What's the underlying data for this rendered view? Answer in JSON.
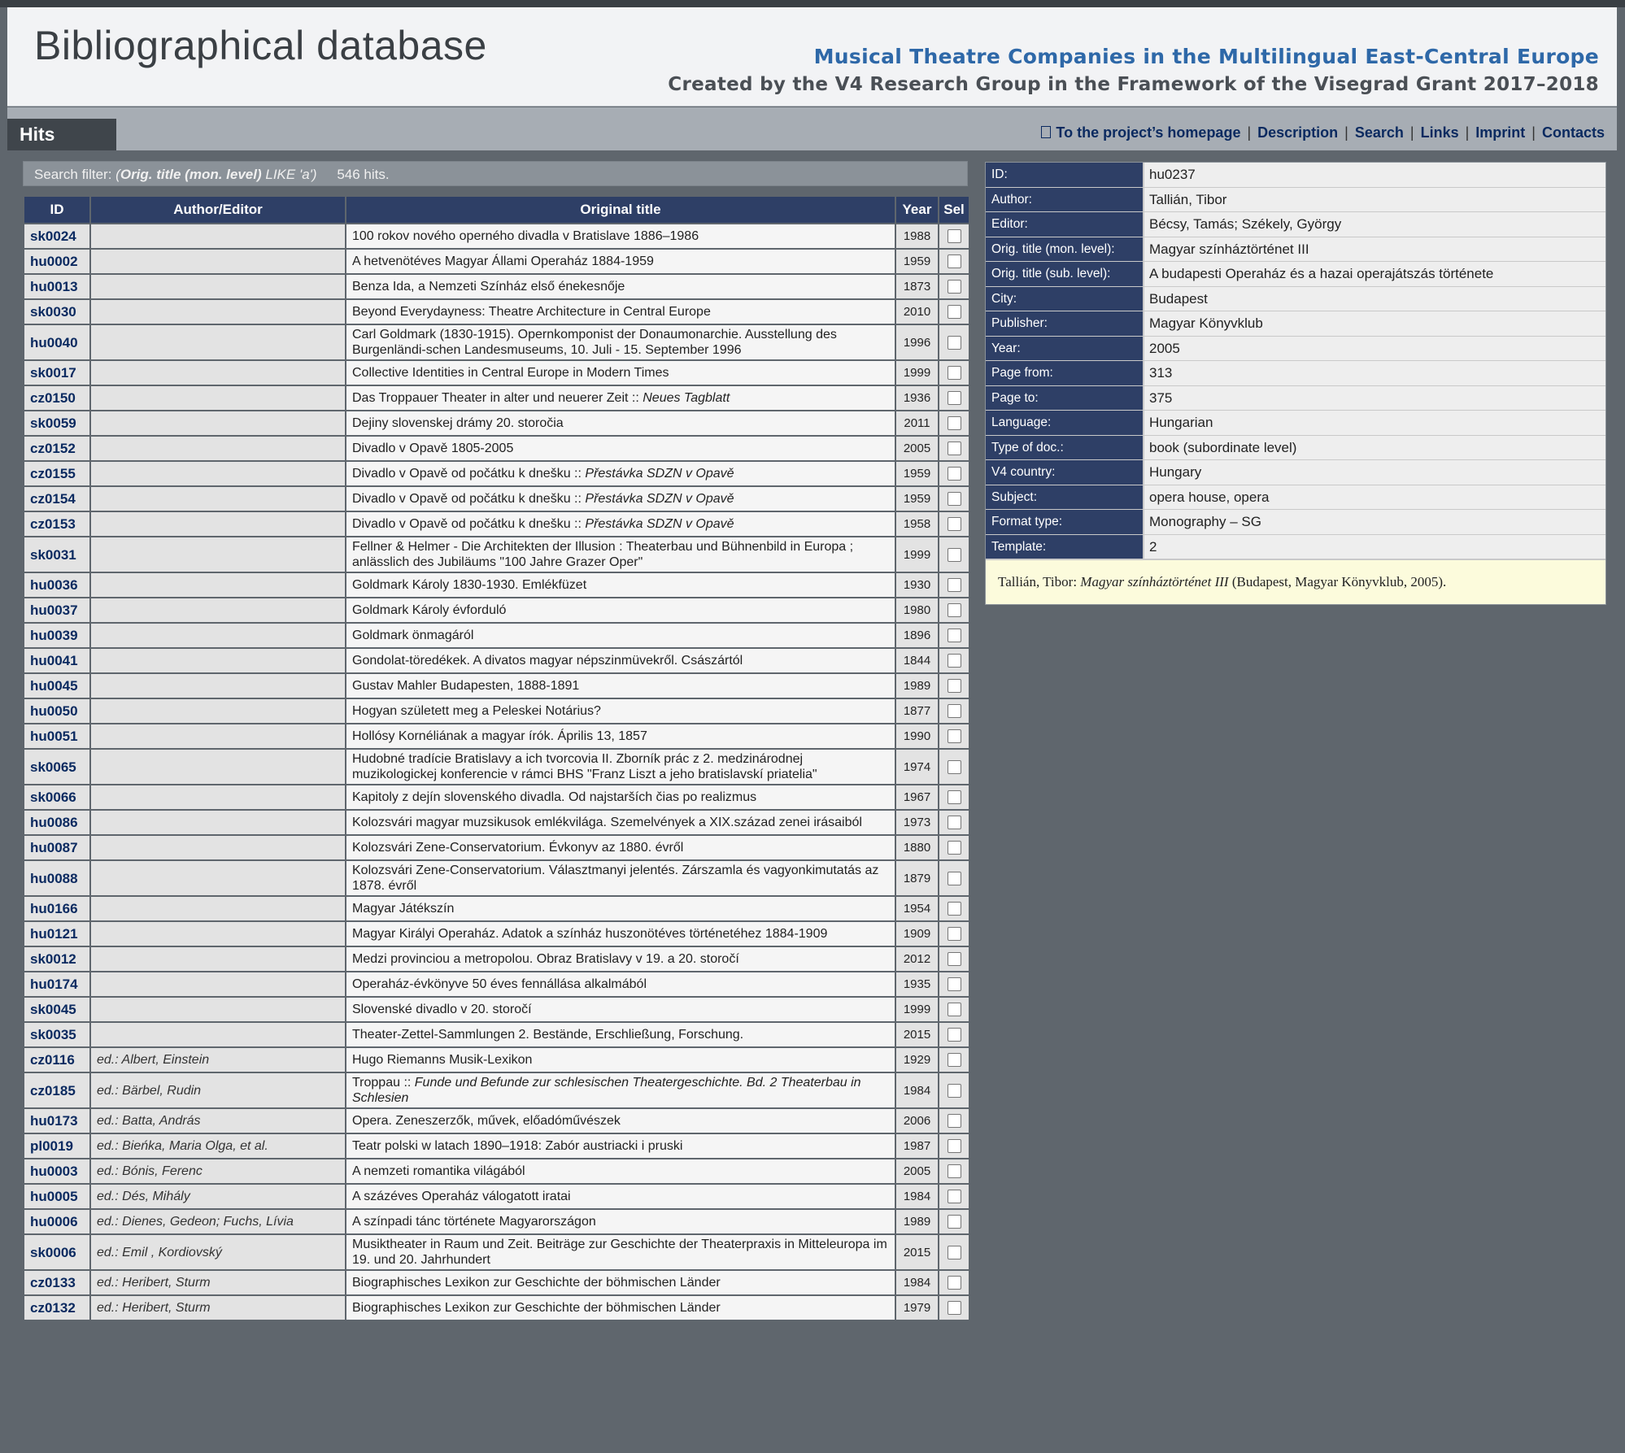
{
  "header": {
    "site_title": "Bibliographical database",
    "project_title": "Musical Theatre Companies in the Multilingual East-Central Europe",
    "project_subtitle": "Created by the V4 Research Group in the Framework of the Visegrad Grant 2017–2018"
  },
  "nav": {
    "tab": "Hits",
    "links": [
      "To the project’s homepage",
      "Description",
      "Search",
      "Links",
      "Imprint",
      "Contacts"
    ]
  },
  "filter": {
    "label": "Search filter:",
    "field": "Orig. title (mon. level)",
    "expr": " LIKE 'a')",
    "open": "(",
    "count": "546 hits."
  },
  "table": {
    "headers": [
      "ID",
      "Author/Editor",
      "Original title",
      "Year",
      "Sel"
    ],
    "rows": [
      {
        "id": "sk0024",
        "author": "",
        "title": "100 rokov nového operného divadla v Bratislave 1886–1986",
        "sub": "",
        "year": "1988"
      },
      {
        "id": "hu0002",
        "author": "",
        "title": "A hetvenötéves Magyar Állami Operaház 1884-1959",
        "sub": "",
        "year": "1959"
      },
      {
        "id": "hu0013",
        "author": "",
        "title": "Benza Ida, a Nemzeti Színház első énekesnője",
        "sub": "",
        "year": "1873"
      },
      {
        "id": "sk0030",
        "author": "",
        "title": "Beyond Everydayness: Theatre Architecture in Central Europe",
        "sub": "",
        "year": "2010"
      },
      {
        "id": "hu0040",
        "author": "",
        "title": "Carl Goldmark (1830-1915). Opernkomponist der Donaumonarchie. Ausstellung des Burgenländi-schen Landesmuseums, 10. Juli - 15. September 1996",
        "sub": "",
        "year": "1996"
      },
      {
        "id": "sk0017",
        "author": "",
        "title": "Collective Identities in Central Europe in Modern Times",
        "sub": "",
        "year": "1999"
      },
      {
        "id": "cz0150",
        "author": "",
        "title": "Das Troppauer Theater in alter und neuerer Zeit :: ",
        "sub": "Neues Tagblatt",
        "year": "1936"
      },
      {
        "id": "sk0059",
        "author": "",
        "title": "Dejiny slovenskej drámy 20. storočia",
        "sub": "",
        "year": "2011"
      },
      {
        "id": "cz0152",
        "author": "",
        "title": "Divadlo v Opavě 1805-2005",
        "sub": "",
        "year": "2005"
      },
      {
        "id": "cz0155",
        "author": "",
        "title": "Divadlo v Opavě od počátku k dnešku :: ",
        "sub": "Přestávka SDZN v Opavě",
        "year": "1959"
      },
      {
        "id": "cz0154",
        "author": "",
        "title": "Divadlo v Opavě od počátku k dnešku :: ",
        "sub": "Přestávka SDZN v Opavě",
        "year": "1959"
      },
      {
        "id": "cz0153",
        "author": "",
        "title": "Divadlo v Opavě od počátku k dnešku :: ",
        "sub": "Přestávka SDZN v Opavě",
        "year": "1958"
      },
      {
        "id": "sk0031",
        "author": "",
        "title": "Fellner & Helmer - Die Architekten der Illusion : Theaterbau und Bühnenbild in Europa ; anlässlich des Jubiläums \"100 Jahre Grazer Oper\"",
        "sub": "",
        "year": "1999"
      },
      {
        "id": "hu0036",
        "author": "",
        "title": "Goldmark Károly 1830-1930. Emlékfüzet",
        "sub": "",
        "year": "1930"
      },
      {
        "id": "hu0037",
        "author": "",
        "title": "Goldmark Károly évforduló",
        "sub": "",
        "year": "1980"
      },
      {
        "id": "hu0039",
        "author": "",
        "title": "Goldmark önmagáról",
        "sub": "",
        "year": "1896"
      },
      {
        "id": "hu0041",
        "author": "",
        "title": "Gondolat-töredékek. A divatos magyar népszinmüvekről. Császártól",
        "sub": "",
        "year": "1844"
      },
      {
        "id": "hu0045",
        "author": "",
        "title": "Gustav Mahler Budapesten, 1888-1891",
        "sub": "",
        "year": "1989"
      },
      {
        "id": "hu0050",
        "author": "",
        "title": "Hogyan született meg a Peleskei Notárius?",
        "sub": "",
        "year": "1877"
      },
      {
        "id": "hu0051",
        "author": "",
        "title": "Hollósy Kornéliának a magyar írók. Április 13, 1857",
        "sub": "",
        "year": "1990"
      },
      {
        "id": "sk0065",
        "author": "",
        "title": "Hudobné tradície Bratislavy a ich tvorcovia II. Zborník prác z 2. medzinárodnej muzikologickej konferencie v rámci BHS \"Franz Liszt a jeho bratislavskí priatelia\"",
        "sub": "",
        "year": "1974"
      },
      {
        "id": "sk0066",
        "author": "",
        "title": "Kapitoly z dejín slovenského divadla. Od najstarších čias po realizmus",
        "sub": "",
        "year": "1967"
      },
      {
        "id": "hu0086",
        "author": "",
        "title": "Kolozsvári magyar muzsikusok emlékvilága. Szemelvények a XIX.század zenei irásaiból",
        "sub": "",
        "year": "1973"
      },
      {
        "id": "hu0087",
        "author": "",
        "title": "Kolozsvári Zene-Conservatorium. Évkonyv az 1880. évről",
        "sub": "",
        "year": "1880"
      },
      {
        "id": "hu0088",
        "author": "",
        "title": "Kolozsvári Zene-Conservatorium. Választmanyi jelentés. Zárszamla és vagyonkimutatás az 1878. évről",
        "sub": "",
        "year": "1879"
      },
      {
        "id": "hu0166",
        "author": "",
        "title": "Magyar Játékszín",
        "sub": "",
        "year": "1954"
      },
      {
        "id": "hu0121",
        "author": "",
        "title": "Magyar Királyi Operaház. Adatok a színház huszonötéves történetéhez 1884-1909",
        "sub": "",
        "year": "1909"
      },
      {
        "id": "sk0012",
        "author": "",
        "title": "Medzi provinciou a metropolou. Obraz Bratislavy v 19. a 20. storočí",
        "sub": "",
        "year": "2012"
      },
      {
        "id": "hu0174",
        "author": "",
        "title": "Operaház-évkönyve 50 éves fennállása alkalmából",
        "sub": "",
        "year": "1935"
      },
      {
        "id": "sk0045",
        "author": "",
        "title": "Slovenské divadlo v 20. storočí",
        "sub": "",
        "year": "1999"
      },
      {
        "id": "sk0035",
        "author": "",
        "title": "Theater-Zettel-Sammlungen 2. Bestände, Erschließung, Forschung.",
        "sub": "",
        "year": "2015"
      },
      {
        "id": "cz0116",
        "author": "ed.: Albert, Einstein",
        "title": "Hugo Riemanns Musik-Lexikon",
        "sub": "",
        "year": "1929"
      },
      {
        "id": "cz0185",
        "author": "ed.: Bärbel, Rudin",
        "title": "Troppau :: ",
        "sub": "Funde und Befunde zur schlesischen Theatergeschichte. Bd. 2 Theaterbau in Schlesien",
        "year": "1984"
      },
      {
        "id": "hu0173",
        "author": "ed.: Batta, András",
        "title": "Opera. Zeneszerzők, művek, előadóművészek",
        "sub": "",
        "year": "2006"
      },
      {
        "id": "pl0019",
        "author": "ed.: Bieńka, Maria Olga, et al.",
        "title": "Teatr polski w latach 1890–1918: Zabór austriacki i pruski",
        "sub": "",
        "year": "1987"
      },
      {
        "id": "hu0003",
        "author": "ed.: Bónis, Ferenc",
        "title": "A nemzeti romantika világából",
        "sub": "",
        "year": "2005"
      },
      {
        "id": "hu0005",
        "author": "ed.: Dés, Mihály",
        "title": "A százéves Operaház válogatott iratai",
        "sub": "",
        "year": "1984"
      },
      {
        "id": "hu0006",
        "author": "ed.: Dienes, Gedeon; Fuchs, Lívia",
        "title": "A színpadi tánc története Magyarországon",
        "sub": "",
        "year": "1989"
      },
      {
        "id": "sk0006",
        "author": "ed.: Emil , Kordiovský",
        "title": "Musiktheater in Raum und Zeit. Beiträge zur Geschichte der Theaterpraxis in Mitteleuropa im 19. und 20. Jahrhundert",
        "sub": "",
        "year": "2015"
      },
      {
        "id": "cz0133",
        "author": "ed.: Heribert, Sturm",
        "title": "Biographisches Lexikon zur Geschichte der böhmischen Länder",
        "sub": "",
        "year": "1984"
      },
      {
        "id": "cz0132",
        "author": "ed.: Heribert, Sturm",
        "title": "Biographisches Lexikon zur Geschichte der böhmischen Länder",
        "sub": "",
        "year": "1979"
      }
    ]
  },
  "detail": {
    "fields": [
      {
        "label": "ID:",
        "value": "hu0237"
      },
      {
        "label": "Author:",
        "value": "Tallián, Tibor"
      },
      {
        "label": "Editor:",
        "value": "Bécsy, Tamás; Székely, György"
      },
      {
        "label": "Orig. title (mon. level):",
        "value": "Magyar színháztörténet III"
      },
      {
        "label": "Orig. title (sub. level):",
        "value": "A budapesti Operaház és a hazai operajátszás története"
      },
      {
        "label": "City:",
        "value": "Budapest"
      },
      {
        "label": "Publisher:",
        "value": "Magyar Könyvklub"
      },
      {
        "label": "Year:",
        "value": "2005"
      },
      {
        "label": "Page from:",
        "value": "313"
      },
      {
        "label": "Page to:",
        "value": "375"
      },
      {
        "label": "Language:",
        "value": "Hungarian"
      },
      {
        "label": "Type of doc.:",
        "value": "book (subordinate level)"
      },
      {
        "label": "V4 country:",
        "value": "Hungary"
      },
      {
        "label": "Subject:",
        "value": "opera house, opera"
      },
      {
        "label": "Format type:",
        "value": "Monography – SG"
      },
      {
        "label": "Template:",
        "value": "2"
      }
    ],
    "citation": {
      "author": "Tallián, Tibor: ",
      "title": "Magyar színháztörténet III",
      "rest": " (Budapest, Magyar Könyvklub, 2005)."
    }
  }
}
